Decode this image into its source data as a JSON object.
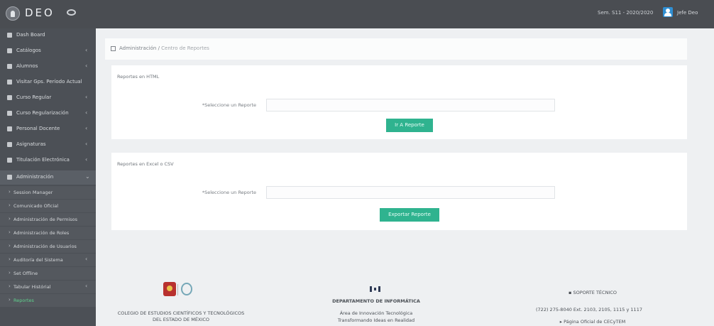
{
  "topbar": {
    "brand": "DEO",
    "term_info": "Sem. S11 - 2020/2020",
    "user_name": "Jefe Deo"
  },
  "sidebar": {
    "items": [
      {
        "label": "Dash Board",
        "icon": "dashboard-icon",
        "has_children": false
      },
      {
        "label": "Catálogos",
        "icon": "catalog-icon",
        "has_children": true
      },
      {
        "label": "Alumnos",
        "icon": "students-icon",
        "has_children": true
      },
      {
        "label": "Visitar Gps. Período Actual",
        "icon": "groups-icon",
        "has_children": false
      },
      {
        "label": "Curso Regular",
        "icon": "edit-icon",
        "has_children": true
      },
      {
        "label": "Curso Regularización",
        "icon": "tools-icon",
        "has_children": true
      },
      {
        "label": "Personal Docente",
        "icon": "teacher-icon",
        "has_children": true
      },
      {
        "label": "Asignaturas",
        "icon": "book-icon",
        "has_children": true
      },
      {
        "label": "Titulación Electrónica",
        "icon": "diploma-icon",
        "has_children": true
      },
      {
        "label": "Administración",
        "icon": "admin-icon",
        "has_children": true
      }
    ],
    "sub_items": [
      {
        "label": "Session Manager",
        "has_children": false
      },
      {
        "label": "Comunicado Oficial",
        "has_children": false
      },
      {
        "label": "Administración de Permisos",
        "has_children": false
      },
      {
        "label": "Administración de Roles",
        "has_children": false
      },
      {
        "label": "Administración de Usuarios",
        "has_children": false
      },
      {
        "label": "Auditoría del Sistema",
        "has_children": true
      },
      {
        "label": "Set Offline",
        "has_children": false
      },
      {
        "label": "Tabular Histórial",
        "has_children": true
      },
      {
        "label": "Reportes",
        "has_children": false
      }
    ]
  },
  "breadcrumb": {
    "section": "Administración",
    "separator": "/",
    "current": "Centro de Reportes"
  },
  "panels": [
    {
      "title": "Reportes en HTML",
      "field_label": "*Seleccione un Reporte",
      "button_label": "Ir A Reporte"
    },
    {
      "title": "Reportes en Excel o CSV",
      "field_label": "*Seleccione un Reporte",
      "button_label": "Exportar Reporte"
    }
  ],
  "footer": {
    "institution_line1": "COLEGIO DE ESTUDIOS CIENTÍFICOS Y TECNOLÓGICOS",
    "institution_line2": "DEL ESTADO DE MÉXICO",
    "department": "DEPARTAMENTO DE INFORMÁTICA",
    "area": "Área de Innovación Tecnológica",
    "slogan": "Transformando Ideas en Realidad",
    "support_title": "SOPORTE TÉCNICO",
    "phone": "(722) 275-8040 Ext. 2103, 2105, 1115 y 1117",
    "website": "Página Oficial de CECyTEM"
  },
  "colors": {
    "accent": "#2fb38f",
    "sidebar_bg": "#4c5056",
    "topbar_bg": "#4a4d52",
    "active_sub_item": "#5fd18d"
  }
}
